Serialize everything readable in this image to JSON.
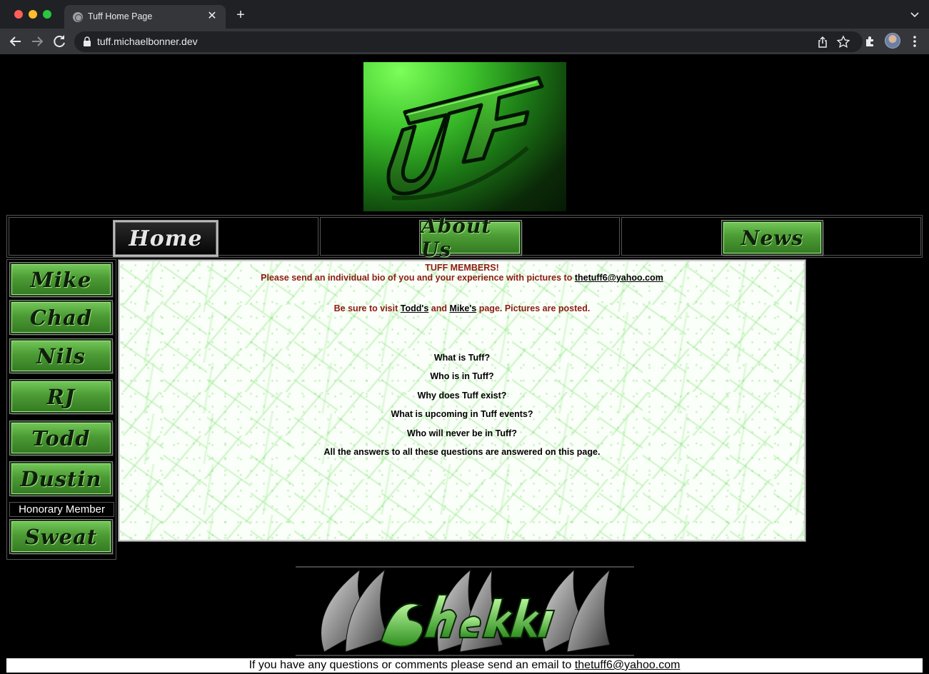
{
  "browser": {
    "tab_title": "Tuff Home Page",
    "tab_close": "✕",
    "new_tab": "+",
    "url": "tuff.michaelbonner.dev"
  },
  "nav": {
    "home": "Home",
    "about": "About Us",
    "news": "News"
  },
  "sidebar": {
    "members": [
      "Mike",
      "Chad",
      "Nils",
      "RJ",
      "Todd",
      "Dustin"
    ],
    "honorary_label": "Honorary Member",
    "honorary_member": "Sweat"
  },
  "content": {
    "heading": "TUFF MEMBERS!",
    "bio_request_prefix": "Please send an individual bio of you and your experience with pictures to",
    "bio_email": "thetuff6@yahoo.com",
    "visit_prefix": "Be sure to visit",
    "visit_link_1": "Todd's",
    "visit_and": "and",
    "visit_link_2": "Mike's",
    "visit_suffix": "page. Pictures are posted.",
    "questions": [
      "What is Tuff?",
      "Who is in Tuff?",
      "Why does Tuff exist?",
      "What is upcoming in Tuff events?",
      "Who will never be in Tuff?",
      "All the answers to all these questions are answered on this page."
    ]
  },
  "footer": {
    "text": "If you have any questions or comments please send an email to",
    "email": "thetuff6@yahoo.com"
  },
  "colors": {
    "logo_green": "#3ec42c",
    "button_green": "#4c9b35",
    "heading_red": "#8b1c12"
  },
  "icons": [
    "back-arrow-icon",
    "forward-arrow-icon",
    "reload-icon",
    "lock-icon",
    "share-icon",
    "star-icon",
    "extensions-icon",
    "menu-icon",
    "globe-icon",
    "chevron-down-icon"
  ]
}
